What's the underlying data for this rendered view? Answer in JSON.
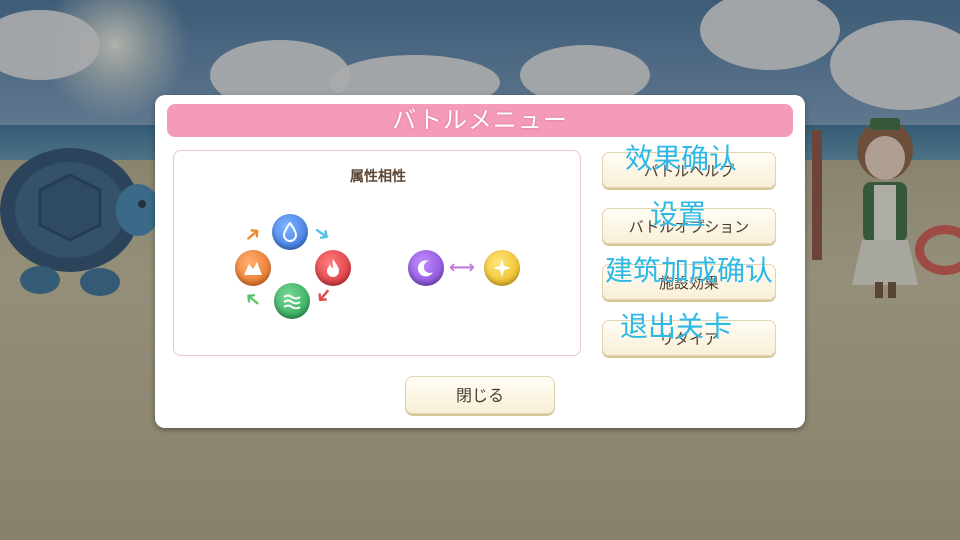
{
  "dialog": {
    "title": "バトルメニュー",
    "attribute_panel": {
      "heading": "属性相性",
      "cycle_elements": [
        "water-element-icon",
        "fire-element-icon",
        "wind-element-icon",
        "earth-element-icon"
      ],
      "mutual_elements": [
        "dark-element-icon",
        "light-element-icon"
      ],
      "colors": {
        "water": "#3f7fe0",
        "fire": "#e0323e",
        "wind": "#2fae5a",
        "earth": "#ec7a2a",
        "dark": "#8a4fd6",
        "light": "#f1c21a",
        "arrow_blue": "#4ec3e6",
        "arrow_red": "#e34b4b",
        "arrow_green": "#62c16c",
        "arrow_orange": "#ef8a2e",
        "arrow_dual": "#c27ad8"
      }
    },
    "menu_buttons": [
      {
        "label": "バトルヘルプ",
        "overlay": "效果确认"
      },
      {
        "label": "バトルオプション",
        "overlay": "设置"
      },
      {
        "label": "施設効果",
        "overlay": "建筑加成确认"
      },
      {
        "label": "リタイア",
        "overlay": "退出关卡"
      }
    ],
    "close_label": "閉じる"
  },
  "colors": {
    "title_bar": "#f49bb8",
    "overlay_text": "#2fb8e6",
    "button_text": "#4a3a2e"
  }
}
